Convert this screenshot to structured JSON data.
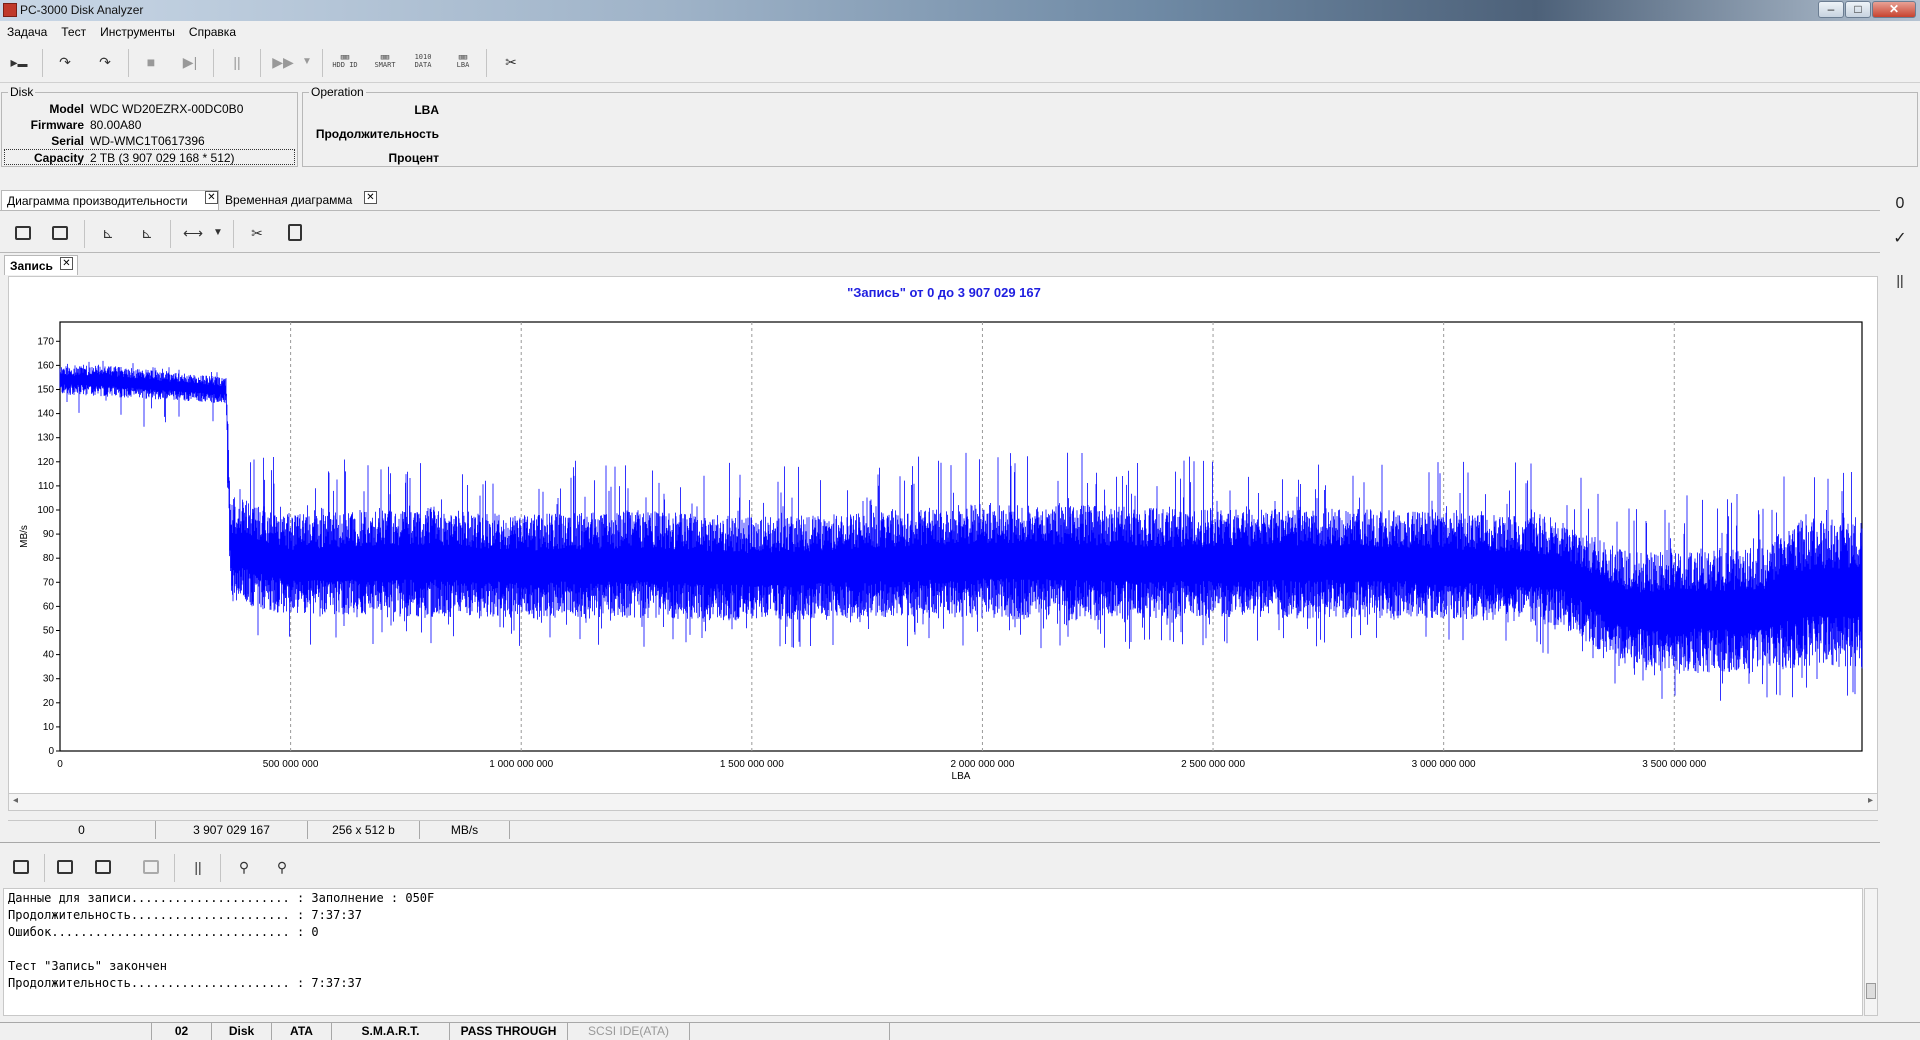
{
  "window": {
    "title": "PC-3000 Disk Analyzer"
  },
  "menu": [
    "Задача",
    "Тест",
    "Инструменты",
    "Справка"
  ],
  "toolbar": {
    "icons": [
      "run-icon",
      "step-in-icon",
      "step-out-icon",
      "stop-icon",
      "skip-icon",
      "pause-icon",
      "fast-forward-icon",
      "dropdown-icon",
      "hdd-id-icon",
      "smart-icon",
      "data-icon",
      "lba-icon",
      "tools-icon"
    ],
    "hdd_id": "HDD ID",
    "smart": "SMART",
    "data": "DATA",
    "lba": "LBA"
  },
  "disk": {
    "group_title": "Disk",
    "model_label": "Model",
    "model": "WDC WD20EZRX-00DC0B0",
    "firmware_label": "Firmware",
    "firmware": "80.00A80",
    "serial_label": "Serial",
    "serial": "WD-WMC1T0617396",
    "capacity_label": "Capacity",
    "capacity": "2 TB (3 907 029 168 * 512)"
  },
  "operation": {
    "group_title": "Operation",
    "lba_label": "LBA",
    "duration_label": "Продолжительность",
    "percent_label": "Процент"
  },
  "tabs": {
    "performance": "Диаграмма производительности",
    "timeline": "Временная диаграмма"
  },
  "subtab": {
    "label": "Запись"
  },
  "chart_data": {
    "type": "line",
    "title": "\"Запись\" от 0 до 3 907 029 167",
    "xlabel": "LBA",
    "ylabel": "MB/s",
    "xlim": [
      0,
      3907029167
    ],
    "ylim": [
      0,
      178
    ],
    "y_ticks": [
      0,
      10,
      20,
      30,
      40,
      50,
      60,
      70,
      80,
      90,
      100,
      110,
      120,
      130,
      140,
      150,
      160,
      170
    ],
    "x_ticks": [
      0,
      500000000,
      1000000000,
      1500000000,
      2000000000,
      2500000000,
      3000000000,
      3500000000
    ],
    "x_tick_labels": [
      "0",
      "500 000 000",
      "1 000 000 000",
      "1 500 000 000",
      "2 000 000 000",
      "2 500 000 000",
      "3 000 000 000",
      "3 500 000 000"
    ],
    "grid": true,
    "color": "#0000ff",
    "series": [
      {
        "x": [
          0,
          100000000,
          200000000,
          300000000,
          360000000,
          370000000,
          500000000,
          750000000,
          1000000000,
          1250000000,
          1500000000,
          1750000000,
          2000000000,
          2250000000,
          2500000000,
          2750000000,
          3000000000,
          3250000000,
          3400000000,
          3500000000,
          3700000000,
          3750000000,
          3800000000,
          3907029167
        ],
        "lo": [
          148,
          147,
          146,
          145,
          144,
          62,
          56,
          55,
          55,
          55,
          54,
          55,
          55,
          54,
          55,
          55,
          55,
          52,
          35,
          33,
          32,
          34,
          35,
          34
        ],
        "hi": [
          160,
          160,
          158,
          156,
          155,
          106,
          98,
          102,
          98,
          100,
          97,
          99,
          103,
          102,
          100,
          101,
          99,
          97,
          82,
          84,
          85,
          95,
          97,
          98
        ]
      }
    ]
  },
  "status_row": {
    "start": "0",
    "end": "3 907 029 167",
    "block": "256 x 512 b",
    "unit": "MB/s"
  },
  "log_lines": [
    "Данные для записи...................... : Заполнение : 050F",
    "Продолжительность...................... : 7:37:37",
    "Ошибок................................. : 0",
    "",
    "Тест \"Запись\" закончен",
    "Продолжительность...................... : 7:37:37"
  ],
  "bottom_bar": {
    "num": "02",
    "disk": "Disk",
    "ata": "ATA",
    "smart": "S.M.A.R.T.",
    "pass": "PASS THROUGH",
    "scsi": "SCSI IDE(ATA)"
  }
}
